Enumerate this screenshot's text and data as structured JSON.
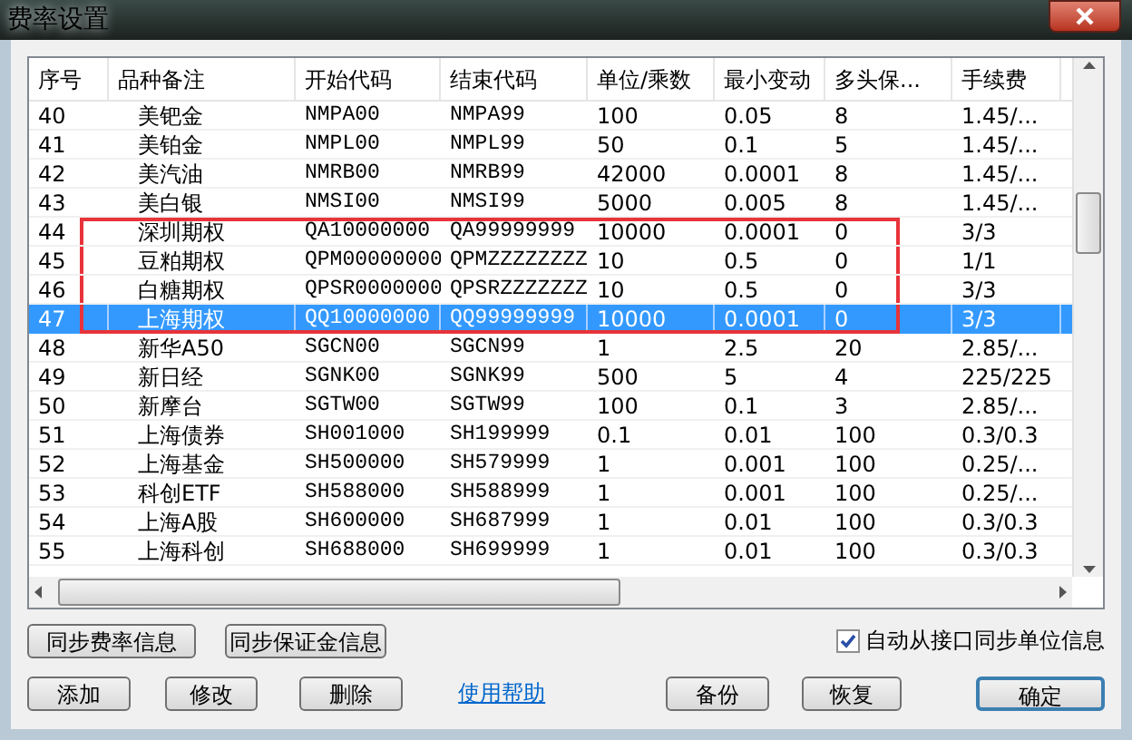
{
  "window": {
    "title": "费率设置"
  },
  "table": {
    "columns": [
      "序号",
      "品种备注",
      "开始代码",
      "结束代码",
      "单位/乘数",
      "最小变动",
      "多头保...",
      "手续费"
    ],
    "rows": [
      {
        "cells": [
          "40",
          "美钯金",
          "NMPA00",
          "NMPA99",
          "100",
          "0.05",
          "8",
          "1.45/..."
        ],
        "selected": false,
        "highlighted": false
      },
      {
        "cells": [
          "41",
          "美铂金",
          "NMPL00",
          "NMPL99",
          "50",
          "0.1",
          "5",
          "1.45/..."
        ],
        "selected": false,
        "highlighted": false
      },
      {
        "cells": [
          "42",
          "美汽油",
          "NMRB00",
          "NMRB99",
          "42000",
          "0.0001",
          "8",
          "1.45/..."
        ],
        "selected": false,
        "highlighted": false
      },
      {
        "cells": [
          "43",
          "美白银",
          "NMSI00",
          "NMSI99",
          "5000",
          "0.005",
          "8",
          "1.45/..."
        ],
        "selected": false,
        "highlighted": false
      },
      {
        "cells": [
          "44",
          "深圳期权",
          "QA10000000",
          "QA99999999",
          "10000",
          "0.0001",
          "0",
          "3/3"
        ],
        "selected": false,
        "highlighted": true
      },
      {
        "cells": [
          "45",
          "豆粕期权",
          "QPM00000000",
          "QPMZZZZZZZZ",
          "10",
          "0.5",
          "0",
          "1/1"
        ],
        "selected": false,
        "highlighted": true
      },
      {
        "cells": [
          "46",
          "白糖期权",
          "QPSR0000000",
          "QPSRZZZZZZZ",
          "10",
          "0.5",
          "0",
          "3/3"
        ],
        "selected": false,
        "highlighted": true
      },
      {
        "cells": [
          "47",
          "上海期权",
          "QQ10000000",
          "QQ99999999",
          "10000",
          "0.0001",
          "0",
          "3/3"
        ],
        "selected": true,
        "highlighted": true
      },
      {
        "cells": [
          "48",
          "新华A50",
          "SGCN00",
          "SGCN99",
          "1",
          "2.5",
          "20",
          "2.85/..."
        ],
        "selected": false,
        "highlighted": false
      },
      {
        "cells": [
          "49",
          "新日经",
          "SGNK00",
          "SGNK99",
          "500",
          "5",
          "4",
          "225/225"
        ],
        "selected": false,
        "highlighted": false
      },
      {
        "cells": [
          "50",
          "新摩台",
          "SGTW00",
          "SGTW99",
          "100",
          "0.1",
          "3",
          "2.85/..."
        ],
        "selected": false,
        "highlighted": false
      },
      {
        "cells": [
          "51",
          "上海债券",
          "SH001000",
          "SH199999",
          "0.1",
          "0.01",
          "100",
          "0.3/0.3"
        ],
        "selected": false,
        "highlighted": false
      },
      {
        "cells": [
          "52",
          "上海基金",
          "SH500000",
          "SH579999",
          "1",
          "0.001",
          "100",
          "0.25/..."
        ],
        "selected": false,
        "highlighted": false
      },
      {
        "cells": [
          "53",
          "科创ETF",
          "SH588000",
          "SH588999",
          "1",
          "0.001",
          "100",
          "0.25/..."
        ],
        "selected": false,
        "highlighted": false
      },
      {
        "cells": [
          "54",
          "上海A股",
          "SH600000",
          "SH687999",
          "1",
          "0.01",
          "100",
          "0.3/0.3"
        ],
        "selected": false,
        "highlighted": false
      },
      {
        "cells": [
          "55",
          "上海科创",
          "SH688000",
          "SH699999",
          "1",
          "0.01",
          "100",
          "0.3/0.3"
        ],
        "selected": false,
        "highlighted": false
      }
    ]
  },
  "sync_buttons": [
    "同步费率信息",
    "同步保证金信息"
  ],
  "auto_sync": {
    "label": "自动从接口同步单位信息",
    "checked": true
  },
  "actions": [
    {
      "label": "添加",
      "kind": "button",
      "default": false
    },
    {
      "label": "修改",
      "kind": "button",
      "default": false
    },
    {
      "label": "删除",
      "kind": "button",
      "default": false
    },
    {
      "label": "使用帮助",
      "kind": "link"
    },
    {
      "label": "备份",
      "kind": "button",
      "default": false
    },
    {
      "label": "恢复",
      "kind": "button",
      "default": false
    },
    {
      "label": "确定",
      "kind": "button",
      "default": true
    }
  ]
}
